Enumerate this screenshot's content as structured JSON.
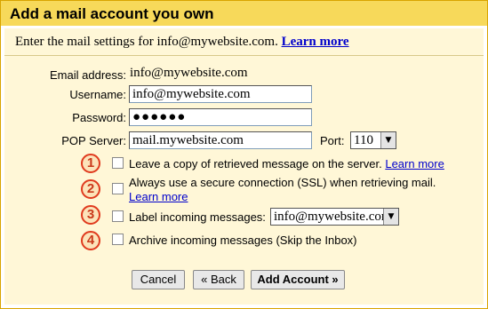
{
  "dialog": {
    "title": "Add a mail account you own",
    "intro_text": "Enter the mail settings for info@mywebsite.com.",
    "intro_link": "Learn more"
  },
  "form": {
    "email_label": "Email address:",
    "email_value": "info@mywebsite.com",
    "username_label": "Username:",
    "username_value": "info@mywebsite.com",
    "password_label": "Password:",
    "password_mask": "●●●●●●",
    "pop_label": "POP Server:",
    "pop_value": "mail.mywebsite.com",
    "port_label": "Port:",
    "port_value": "110"
  },
  "options": [
    {
      "number": "1",
      "text": "Leave a copy of retrieved message on the server.",
      "link": "Learn more",
      "checked": false
    },
    {
      "number": "2",
      "text": "Always use a secure connection (SSL) when retrieving mail.",
      "link": "Learn more",
      "checked": false
    },
    {
      "number": "3",
      "text": "Label incoming messages:",
      "select_value": "info@mywebsite.com",
      "checked": false
    },
    {
      "number": "4",
      "text": "Archive incoming messages (Skip the Inbox)",
      "checked": false
    }
  ],
  "buttons": {
    "cancel": "Cancel",
    "back": "« Back",
    "add": "Add Account »"
  },
  "colors": {
    "title_bar": "#f7d95a",
    "panel": "#fff7d7",
    "link": "#0000cc",
    "badge_ring": "#e03a1e"
  }
}
